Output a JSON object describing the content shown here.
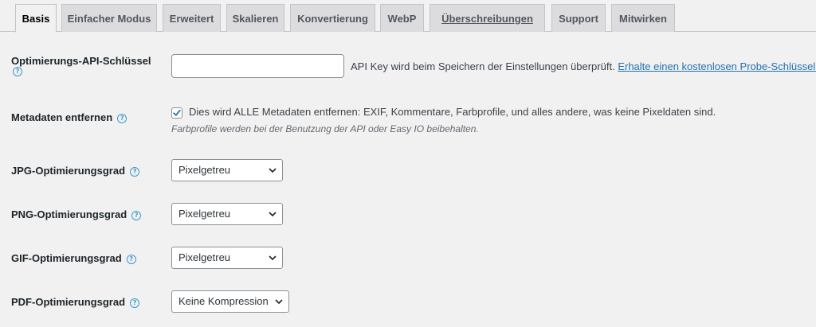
{
  "tabs": [
    {
      "label": "Basis",
      "active": true
    },
    {
      "label": "Einfacher Modus"
    },
    {
      "label": "Erweitert"
    },
    {
      "label": "Skalieren"
    },
    {
      "label": "Konvertierung"
    },
    {
      "label": "WebP"
    },
    {
      "label": "Überschreibungen",
      "underlined": true
    },
    {
      "label": "Support"
    },
    {
      "label": "Mitwirken"
    }
  ],
  "api_key": {
    "label": "Optimierungs-API-Schlüssel",
    "value": "",
    "description": "API Key wird beim Speichern der Einstellungen überprüft.",
    "link_text": "Erhalte einen kostenlosen Probe-Schlüssel."
  },
  "metadata": {
    "label": "Metadaten entfernen",
    "checked": true,
    "description": "Dies wird ALLE Metadaten entfernen: EXIF, Kommentare, Farbprofile, und alles andere, was keine Pixeldaten sind.",
    "note": "Farbprofile werden bei der Benutzung der API oder Easy IO beibehalten."
  },
  "jpg": {
    "label": "JPG-Optimierungsgrad",
    "selected": "Pixelgetreu"
  },
  "png": {
    "label": "PNG-Optimierungsgrad",
    "selected": "Pixelgetreu"
  },
  "gif": {
    "label": "GIF-Optimierungsgrad",
    "selected": "Pixelgetreu"
  },
  "pdf": {
    "label": "PDF-Optimierungsgrad",
    "selected": "Keine Kompression"
  },
  "icons": {
    "help": "question-mark-circle-icon",
    "dropdown": "chevron-down-icon",
    "check": "checkmark-icon"
  },
  "colors": {
    "accent": "#2271b1",
    "help_icon": "#3a9ac9",
    "background": "#f1f1f1"
  }
}
